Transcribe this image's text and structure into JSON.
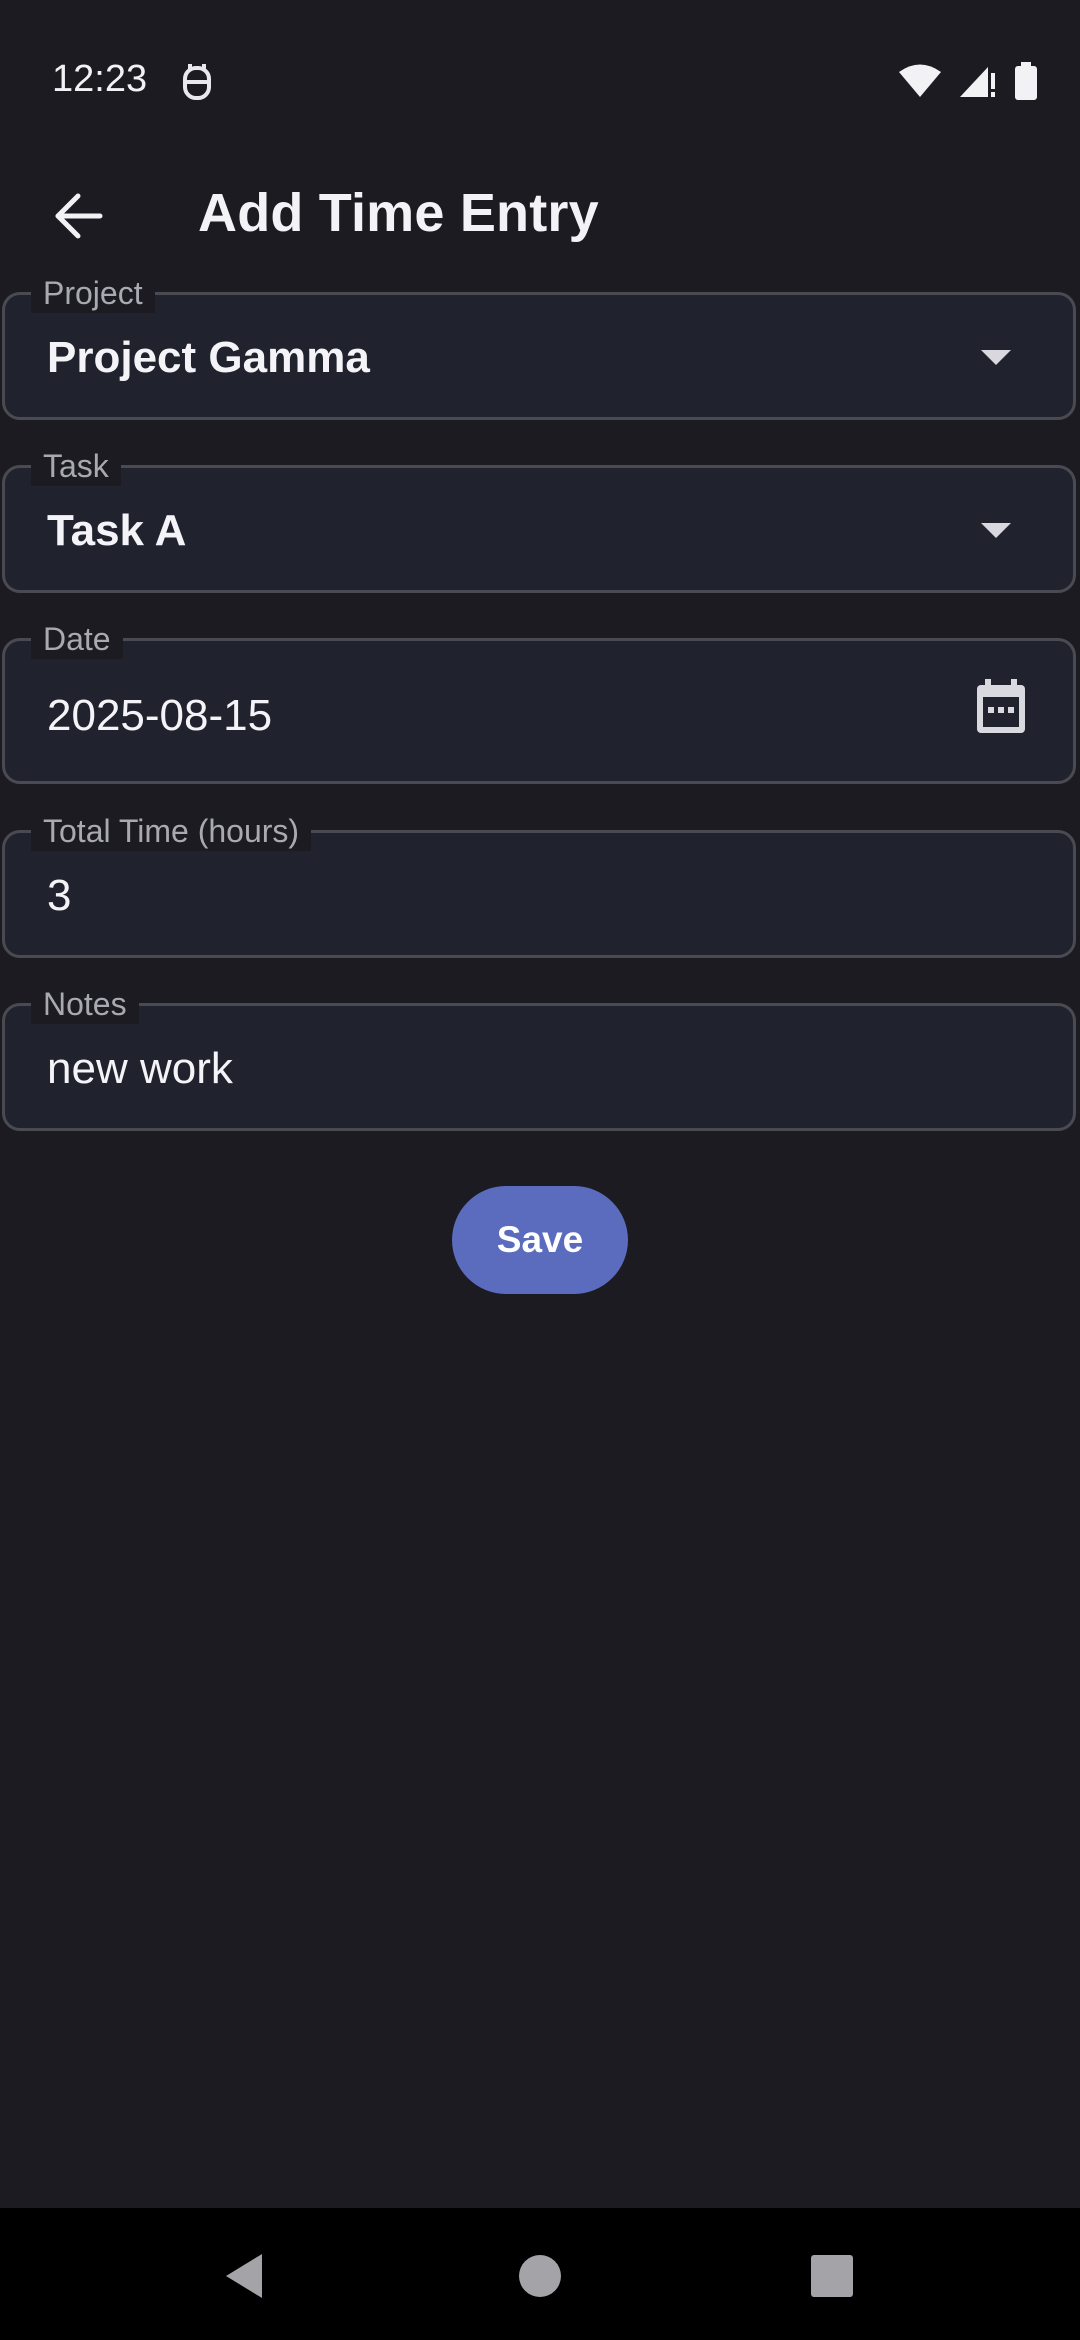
{
  "status_bar": {
    "time": "12:23"
  },
  "app_bar": {
    "title": "Add Time Entry"
  },
  "form": {
    "project": {
      "label": "Project",
      "value": "Project Gamma"
    },
    "task": {
      "label": "Task",
      "value": "Task A"
    },
    "date": {
      "label": "Date",
      "value": "2025-08-15"
    },
    "total_time": {
      "label": "Total Time (hours)",
      "value": "3"
    },
    "notes": {
      "label": "Notes",
      "value": "new work"
    }
  },
  "actions": {
    "save_label": "Save"
  },
  "icons": {
    "back": "arrow-back-icon",
    "project_dropdown": "dropdown-arrow-icon",
    "task_dropdown": "dropdown-arrow-icon",
    "date_picker": "calendar-icon",
    "nav_back": "nav-back-icon",
    "nav_home": "nav-home-icon",
    "nav_recents": "nav-recents-icon",
    "status_app": "app-notification-icon",
    "status_wifi": "wifi-icon",
    "status_signal": "signal-icon",
    "status_battery": "battery-icon"
  },
  "colors": {
    "background": "#1b1b21",
    "field_background": "#20222d",
    "field_border": "#4a4a52",
    "accent": "#5b6bbd",
    "label": "#a9a9b2"
  }
}
